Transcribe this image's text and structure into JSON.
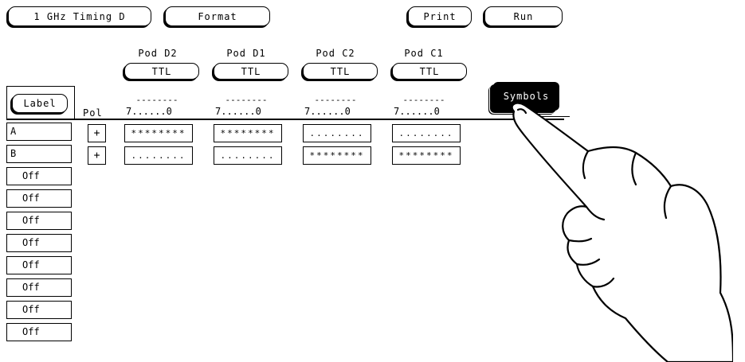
{
  "toolbar": {
    "menu_label": "1 GHz Timing D",
    "format_label": "Format",
    "print_label": "Print",
    "run_label": "Run"
  },
  "label_header": "Label",
  "pol_header": "Pol",
  "pods": [
    {
      "name": "Pod D2",
      "threshold": "TTL",
      "dashes": "--------",
      "range": "7......0"
    },
    {
      "name": "Pod D1",
      "threshold": "TTL",
      "dashes": "--------",
      "range": "7......0"
    },
    {
      "name": "Pod C2",
      "threshold": "TTL",
      "dashes": "--------",
      "range": "7......0"
    },
    {
      "name": "Pod C1",
      "threshold": "TTL",
      "dashes": "--------",
      "range": "7......0"
    }
  ],
  "symbols_label": "Symbols",
  "labels": [
    {
      "name": "A",
      "polarity": "+",
      "patterns": [
        "********",
        "********",
        "........",
        "........"
      ]
    },
    {
      "name": "B",
      "polarity": "+",
      "patterns": [
        "........",
        "........",
        "********",
        "********"
      ]
    },
    {
      "name": "Off"
    },
    {
      "name": "Off"
    },
    {
      "name": "Off"
    },
    {
      "name": "Off"
    },
    {
      "name": "Off"
    },
    {
      "name": "Off"
    },
    {
      "name": "Off"
    },
    {
      "name": "Off"
    }
  ]
}
